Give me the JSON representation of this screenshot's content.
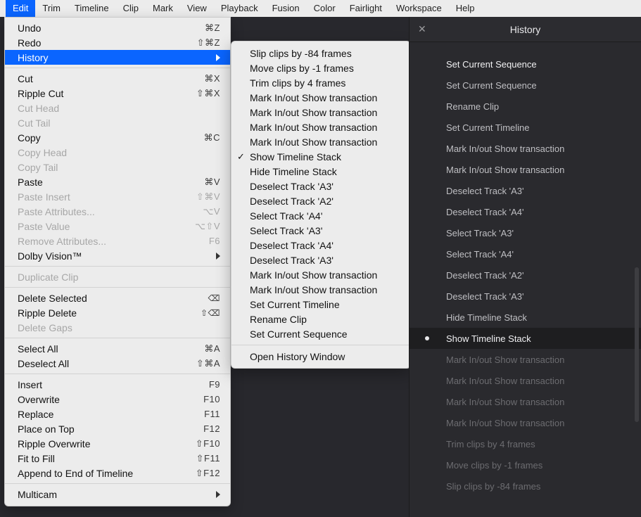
{
  "menubar": {
    "items": [
      "Edit",
      "Trim",
      "Timeline",
      "Clip",
      "Mark",
      "View",
      "Playback",
      "Fusion",
      "Color",
      "Fairlight",
      "Workspace",
      "Help"
    ],
    "active_index": 0
  },
  "edit_menu": {
    "sections": [
      [
        {
          "label": "Undo",
          "shortcut": "⌘Z",
          "disabled": false
        },
        {
          "label": "Redo",
          "shortcut": "⇧⌘Z",
          "disabled": false
        },
        {
          "label": "History",
          "submenu": true,
          "highlight": true
        }
      ],
      [
        {
          "label": "Cut",
          "shortcut": "⌘X",
          "disabled": false
        },
        {
          "label": "Ripple Cut",
          "shortcut": "⇧⌘X",
          "disabled": false
        },
        {
          "label": "Cut Head",
          "disabled": true
        },
        {
          "label": "Cut Tail",
          "disabled": true
        },
        {
          "label": "Copy",
          "shortcut": "⌘C",
          "disabled": false
        },
        {
          "label": "Copy Head",
          "disabled": true
        },
        {
          "label": "Copy Tail",
          "disabled": true
        },
        {
          "label": "Paste",
          "shortcut": "⌘V",
          "disabled": false
        },
        {
          "label": "Paste Insert",
          "shortcut": "⇧⌘V",
          "disabled": true
        },
        {
          "label": "Paste Attributes...",
          "shortcut": "⌥V",
          "disabled": true
        },
        {
          "label": "Paste Value",
          "shortcut": "⌥⇧V",
          "disabled": true
        },
        {
          "label": "Remove Attributes...",
          "shortcut": "F6",
          "disabled": true
        },
        {
          "label": "Dolby Vision™",
          "submenu": true
        }
      ],
      [
        {
          "label": "Duplicate Clip",
          "disabled": true
        }
      ],
      [
        {
          "label": "Delete Selected",
          "shortcut_icon": "⌫",
          "disabled": false
        },
        {
          "label": "Ripple Delete",
          "shortcut_icon": "⇧⌫",
          "disabled": false
        },
        {
          "label": "Delete Gaps",
          "disabled": true
        }
      ],
      [
        {
          "label": "Select All",
          "shortcut": "⌘A",
          "disabled": false
        },
        {
          "label": "Deselect All",
          "shortcut": "⇧⌘A",
          "disabled": false
        }
      ],
      [
        {
          "label": "Insert",
          "shortcut": "F9",
          "disabled": false
        },
        {
          "label": "Overwrite",
          "shortcut": "F10",
          "disabled": false
        },
        {
          "label": "Replace",
          "shortcut": "F11",
          "disabled": false
        },
        {
          "label": "Place on Top",
          "shortcut": "F12",
          "disabled": false
        },
        {
          "label": "Ripple Overwrite",
          "shortcut": "⇧F10",
          "disabled": false
        },
        {
          "label": "Fit to Fill",
          "shortcut": "⇧F11",
          "disabled": false
        },
        {
          "label": "Append to End of Timeline",
          "shortcut": "⇧F12",
          "disabled": false
        }
      ],
      [
        {
          "label": "Multicam",
          "submenu": true,
          "truncated": true
        }
      ]
    ]
  },
  "history_submenu": {
    "items": [
      {
        "label": "Slip clips by -84 frames"
      },
      {
        "label": "Move clips by -1 frames"
      },
      {
        "label": "Trim clips by 4 frames"
      },
      {
        "label": "Mark In/out Show transaction"
      },
      {
        "label": "Mark In/out Show transaction"
      },
      {
        "label": "Mark In/out Show transaction"
      },
      {
        "label": "Mark In/out Show transaction"
      },
      {
        "label": "Show Timeline Stack",
        "checked": true
      },
      {
        "label": "Hide Timeline Stack"
      },
      {
        "label": "Deselect Track 'A3'"
      },
      {
        "label": "Deselect Track 'A2'"
      },
      {
        "label": "Select Track 'A4'"
      },
      {
        "label": "Select Track 'A3'"
      },
      {
        "label": "Deselect Track 'A4'"
      },
      {
        "label": "Deselect Track 'A3'"
      },
      {
        "label": "Mark In/out Show transaction"
      },
      {
        "label": "Mark In/out Show transaction"
      },
      {
        "label": "Set Current Timeline"
      },
      {
        "label": "Rename Clip"
      },
      {
        "label": "Set Current Sequence"
      }
    ],
    "footer": {
      "label": "Open History Window"
    }
  },
  "history_panel": {
    "title": "History",
    "items": [
      {
        "label": "Set Current Sequence",
        "state": "top"
      },
      {
        "label": "Set Current Sequence"
      },
      {
        "label": "Rename Clip"
      },
      {
        "label": "Set Current Timeline"
      },
      {
        "label": "Mark In/out Show transaction"
      },
      {
        "label": "Mark In/out Show transaction"
      },
      {
        "label": "Deselect Track 'A3'"
      },
      {
        "label": "Deselect Track 'A4'"
      },
      {
        "label": "Select Track 'A3'"
      },
      {
        "label": "Select Track 'A4'"
      },
      {
        "label": "Deselect Track 'A2'"
      },
      {
        "label": "Deselect Track 'A3'"
      },
      {
        "label": "Hide Timeline Stack"
      },
      {
        "label": "Show Timeline Stack",
        "state": "current"
      },
      {
        "label": "Mark In/out Show transaction",
        "state": "undone"
      },
      {
        "label": "Mark In/out Show transaction",
        "state": "undone"
      },
      {
        "label": "Mark In/out Show transaction",
        "state": "undone"
      },
      {
        "label": "Mark In/out Show transaction",
        "state": "undone"
      },
      {
        "label": "Trim clips by 4 frames",
        "state": "undone"
      },
      {
        "label": "Move clips by -1 frames",
        "state": "undone"
      },
      {
        "label": "Slip clips by -84 frames",
        "state": "undone"
      }
    ]
  }
}
